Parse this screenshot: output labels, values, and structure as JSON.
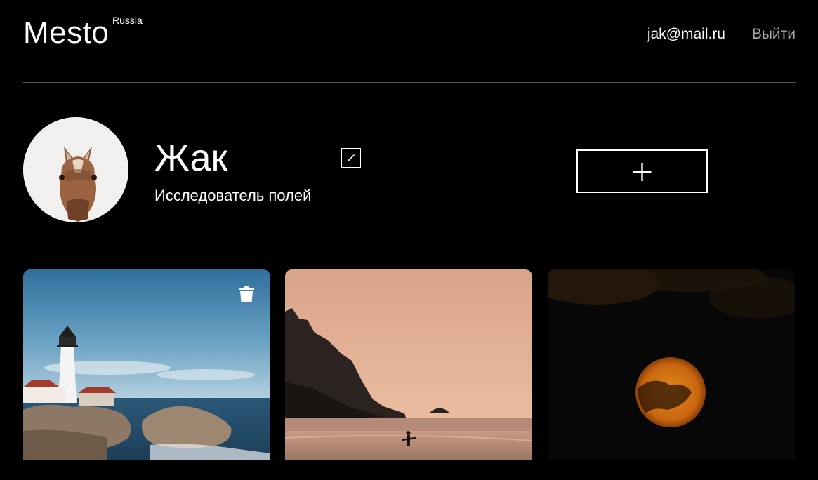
{
  "header": {
    "logo": "Mesto",
    "logo_sup": "Russia",
    "email": "jak@mail.ru",
    "logout_label": "Выйти"
  },
  "profile": {
    "name": "Жак",
    "about": "Исследователь полей",
    "avatar_icon": "horse-avatar",
    "edit_icon": "pencil-icon",
    "add_icon": "plus-icon"
  },
  "cards": [
    {
      "image": "lighthouse-on-rocky-coast",
      "has_delete": true
    },
    {
      "image": "surfer-on-beach-at-dusk",
      "has_delete": false
    },
    {
      "image": "orange-moon-at-night",
      "has_delete": false
    }
  ],
  "colors": {
    "background": "#000000",
    "text": "#ffffff",
    "muted": "#a9a9a9",
    "divider": "#545454"
  }
}
